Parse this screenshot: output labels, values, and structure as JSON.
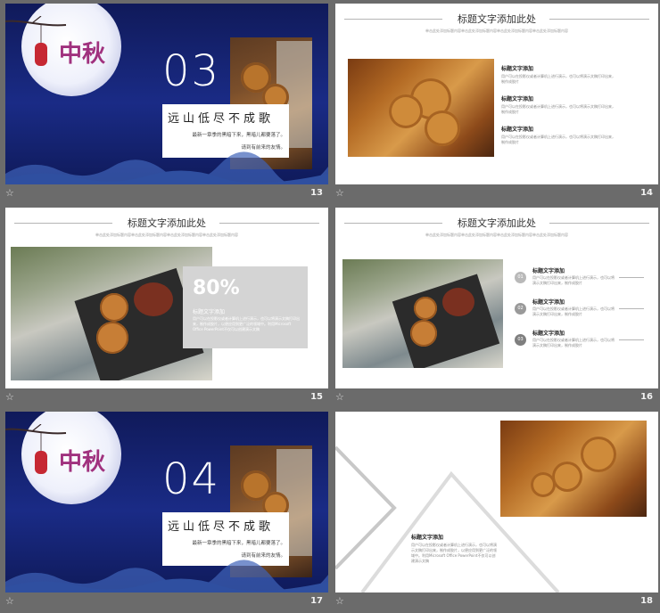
{
  "slides": [
    {
      "number": "13",
      "big_number": "03",
      "poem_title": "远山低尽不成歌",
      "poem_line1": "最新一章季的黑暗下来，黑暗儿都要落了。",
      "poem_line2": "请到有前来的友情。"
    },
    {
      "number": "14",
      "title": "标题文字添加此处",
      "subtitle": "单击此处添加标题内容单击此处添加标题内容单击此处添加标题内容单击此处添加标题内容",
      "items": [
        {
          "title": "标题文字添加",
          "text": "用户可以在投影仪或者计算机上进行演示，也可以将演示文稿打印出来，制作成胶片"
        },
        {
          "title": "标题文字添加",
          "text": "用户可以在投影仪或者计算机上进行演示，也可以将演示文稿打印出来，制作成胶片"
        },
        {
          "title": "标题文字添加",
          "text": "用户可以在投影仪或者计算机上进行演示，也可以将演示文稿打印出来，制作成胶片"
        }
      ]
    },
    {
      "number": "15",
      "title": "标题文字添加此处",
      "subtitle": "单击此处添加标题内容单击此处添加标题内容单击此处添加标题内容单击此处添加标题内容",
      "percent": "80%",
      "box_title": "标题文字添加",
      "box_text": "用户可以在投影仪或者计算机上进行演示，也可以将演示文稿打印出来，制作成胶片，以便应用到更广泛的领域中。利用Microsoft Office PowerPoint不仅可以创建演示文稿"
    },
    {
      "number": "16",
      "title": "标题文字添加此处",
      "subtitle": "单击此处添加标题内容单击此处添加标题内容单击此处添加标题内容单击此处添加标题内容",
      "items": [
        {
          "num": "01",
          "title": "标题文字添加",
          "text": "用户可以在投影仪或者计算机上进行演示，也可以将演示文稿打印出来，制作成胶片"
        },
        {
          "num": "02",
          "title": "标题文字添加",
          "text": "用户可以在投影仪或者计算机上进行演示，也可以将演示文稿打印出来，制作成胶片"
        },
        {
          "num": "03",
          "title": "标题文字添加",
          "text": "用户可以在投影仪或者计算机上进行演示，也可以将演示文稿打印出来，制作成胶片"
        }
      ]
    },
    {
      "number": "17",
      "big_number": "04",
      "poem_title": "远山低尽不成歌",
      "poem_line1": "最新一章季的黑暗下来，黑暗儿都要落了。",
      "poem_line2": "请到有前来的友情。"
    },
    {
      "number": "18",
      "item_title": "标题文字添加",
      "item_text": "用户可以在投影仪或者计算机上进行演示，也可以将演示文稿打印出来，制作成胶片，以便应用到更广泛的领域中。利用Microsoft Office PowerPoint不仅可以创建演示文稿"
    }
  ],
  "logo_text": "中秋",
  "star_icon": "star-icon",
  "colors": {
    "background": "#6b6b6b",
    "dark_slide": "#1a2b86",
    "gray_accent": "#8c8c8c",
    "lantern": "#c62833",
    "logo": "#a0317e"
  }
}
